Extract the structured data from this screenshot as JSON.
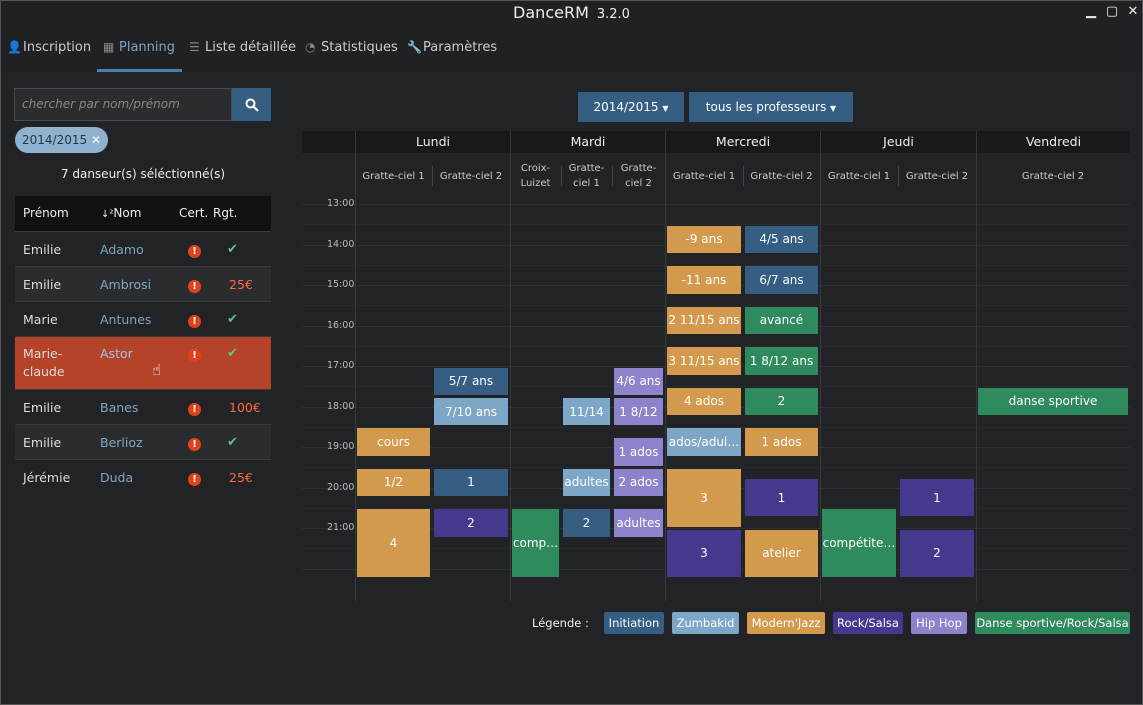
{
  "window": {
    "title": "DanceRM",
    "version": "3.2.0",
    "minimize": "▁",
    "maximize": "▢",
    "close": "✕"
  },
  "nav": {
    "inscription": "Inscription",
    "planning": "Planning",
    "liste": "Liste détaillée",
    "statistiques": "Statistiques",
    "parametres": "Paramètres"
  },
  "search": {
    "placeholder": "chercher par nom/prénom"
  },
  "filter_tag": "2014/2015",
  "selection_count": "7 danseur(s) séléctionné(s)",
  "table": {
    "headers": {
      "prenom": "Prénom",
      "nom": "Nom",
      "cert": "Cert.",
      "rgt": "Rgt."
    },
    "rows": [
      {
        "prenom": "Emilie",
        "nom": "Adamo",
        "rgt": "✔"
      },
      {
        "prenom": "Emilie",
        "nom": "Ambrosi",
        "rgt": "25€"
      },
      {
        "prenom": "Marie",
        "nom": "Antunes",
        "rgt": "✔"
      },
      {
        "prenom": "Marie-",
        "prenom2": "claude",
        "nom": "Astor",
        "rgt": "✔"
      },
      {
        "prenom": "Emilie",
        "nom": "Banes",
        "rgt": "100€"
      },
      {
        "prenom": "Emilie",
        "nom": "Berlioz",
        "rgt": "✔"
      },
      {
        "prenom": "Jérémie",
        "nom": "Duda",
        "rgt": "25€"
      }
    ]
  },
  "planning": {
    "season_dropdown": "2014/2015",
    "teacher_dropdown": "tous les professeurs",
    "days": [
      "Lundi",
      "Mardi",
      "Mercredi",
      "Jeudi",
      "Vendredi"
    ],
    "rooms": [
      "Gratte-ciel 1",
      "Gratte-ciel 2",
      "Croix-Luizet",
      "Gratte-ciel 1",
      "Gratte-ciel 2",
      "Gratte-ciel 1",
      "Gratte-ciel 2",
      "Gratte-ciel 1",
      "Gratte-ciel 2",
      "Gratte-ciel 2"
    ],
    "rooms_display": [
      "Gratte-ciel 1",
      "Gratte-ciel 2",
      "Croix-\nLuizet",
      "Gratte-\nciel 1",
      "Gratte-\nciel 2",
      "Gratte-ciel 1",
      "Gratte-ciel 2",
      "Gratte-ciel 1",
      "Gratte-ciel 2",
      "Gratte-ciel 2"
    ],
    "hours": [
      "13:00",
      "14:00",
      "15:00",
      "16:00",
      "17:00",
      "18:00",
      "19:00",
      "20:00",
      "21:00"
    ],
    "events": [
      {
        "col": 0,
        "start": "18:30",
        "end": "19:15",
        "label": "cours",
        "type": "Modern'Jazz"
      },
      {
        "col": 0,
        "start": "19:30",
        "end": "20:15",
        "label": "1/2",
        "type": "Modern'Jazz"
      },
      {
        "col": 0,
        "start": "20:30",
        "end": "22:15",
        "label": "4",
        "type": "Modern'Jazz"
      },
      {
        "col": 1,
        "start": "17:00",
        "end": "17:45",
        "label": "5/7 ans",
        "type": "Initiation"
      },
      {
        "col": 1,
        "start": "17:45",
        "end": "18:30",
        "label": "7/10 ans",
        "type": "Zumbakid"
      },
      {
        "col": 1,
        "start": "19:30",
        "end": "20:15",
        "label": "1",
        "type": "Initiation"
      },
      {
        "col": 1,
        "start": "20:30",
        "end": "21:15",
        "label": "2",
        "type": "Rock/Salsa"
      },
      {
        "col": 2,
        "start": "20:30",
        "end": "22:15",
        "label": "comp…",
        "type": "Danse sportive/Rock/Salsa"
      },
      {
        "col": 3,
        "start": "17:45",
        "end": "18:30",
        "label": "11/14",
        "type": "Zumbakid"
      },
      {
        "col": 3,
        "start": "19:30",
        "end": "20:15",
        "label": "adultes",
        "type": "Zumbakid"
      },
      {
        "col": 3,
        "start": "20:30",
        "end": "21:15",
        "label": "2",
        "type": "Initiation"
      },
      {
        "col": 4,
        "start": "17:00",
        "end": "17:45",
        "label": "4/6 ans",
        "type": "Hip Hop"
      },
      {
        "col": 4,
        "start": "17:45",
        "end": "18:30",
        "label": "1 8/12",
        "type": "Hip Hop"
      },
      {
        "col": 4,
        "start": "18:45",
        "end": "19:30",
        "label": "1 ados",
        "type": "Hip Hop"
      },
      {
        "col": 4,
        "start": "19:30",
        "end": "20:15",
        "label": "2 ados",
        "type": "Hip Hop"
      },
      {
        "col": 4,
        "start": "20:30",
        "end": "21:15",
        "label": "adultes",
        "type": "Hip Hop"
      },
      {
        "col": 5,
        "start": "13:30",
        "end": "14:15",
        "label": "-9 ans",
        "type": "Modern'Jazz"
      },
      {
        "col": 5,
        "start": "14:30",
        "end": "15:15",
        "label": "-11 ans",
        "type": "Modern'Jazz"
      },
      {
        "col": 5,
        "start": "15:30",
        "end": "16:15",
        "label": "2 11/15 ans",
        "type": "Modern'Jazz"
      },
      {
        "col": 5,
        "start": "16:30",
        "end": "17:15",
        "label": "3 11/15 ans",
        "type": "Modern'Jazz"
      },
      {
        "col": 5,
        "start": "17:30",
        "end": "18:15",
        "label": "4 ados",
        "type": "Modern'Jazz"
      },
      {
        "col": 5,
        "start": "18:30",
        "end": "19:15",
        "label": "ados/adul…",
        "type": "Zumbakid"
      },
      {
        "col": 5,
        "start": "19:30",
        "end": "21:00",
        "label": "3",
        "type": "Modern'Jazz"
      },
      {
        "col": 5,
        "start": "21:00",
        "end": "22:15",
        "label": "3",
        "type": "Rock/Salsa"
      },
      {
        "col": 6,
        "start": "13:30",
        "end": "14:15",
        "label": "4/5 ans",
        "type": "Initiation"
      },
      {
        "col": 6,
        "start": "14:30",
        "end": "15:15",
        "label": "6/7 ans",
        "type": "Initiation"
      },
      {
        "col": 6,
        "start": "15:30",
        "end": "16:15",
        "label": "avancé",
        "type": "Danse sportive/Rock/Salsa"
      },
      {
        "col": 6,
        "start": "16:30",
        "end": "17:15",
        "label": "1 8/12 ans",
        "type": "Danse sportive/Rock/Salsa"
      },
      {
        "col": 6,
        "start": "17:30",
        "end": "18:15",
        "label": "2",
        "type": "Danse sportive/Rock/Salsa"
      },
      {
        "col": 6,
        "start": "18:30",
        "end": "19:15",
        "label": "1 ados",
        "type": "Modern'Jazz"
      },
      {
        "col": 6,
        "start": "19:45",
        "end": "20:45",
        "label": "1",
        "type": "Rock/Salsa"
      },
      {
        "col": 6,
        "start": "21:00",
        "end": "22:15",
        "label": "atelier",
        "type": "Modern'Jazz"
      },
      {
        "col": 7,
        "start": "20:30",
        "end": "22:15",
        "label": "compétite…",
        "type": "Danse sportive/Rock/Salsa"
      },
      {
        "col": 8,
        "start": "19:45",
        "end": "20:45",
        "label": "1",
        "type": "Rock/Salsa"
      },
      {
        "col": 8,
        "start": "21:00",
        "end": "22:15",
        "label": "2",
        "type": "Rock/Salsa"
      },
      {
        "col": 9,
        "start": "17:30",
        "end": "18:15",
        "label": "danse sportive",
        "type": "Danse sportive/Rock/Salsa"
      }
    ],
    "legend_label": "Légende :",
    "legend": [
      {
        "name": "Initiation",
        "color": "#355e82"
      },
      {
        "name": "Zumbakid",
        "color": "#7ea6c6"
      },
      {
        "name": "Modern'Jazz",
        "color": "#d39a4e"
      },
      {
        "name": "Rock/Salsa",
        "color": "#45398d"
      },
      {
        "name": "Hip Hop",
        "color": "#8d83cc"
      },
      {
        "name": "Danse sportive/Rock/Salsa",
        "color": "#2f8a5d"
      }
    ]
  }
}
